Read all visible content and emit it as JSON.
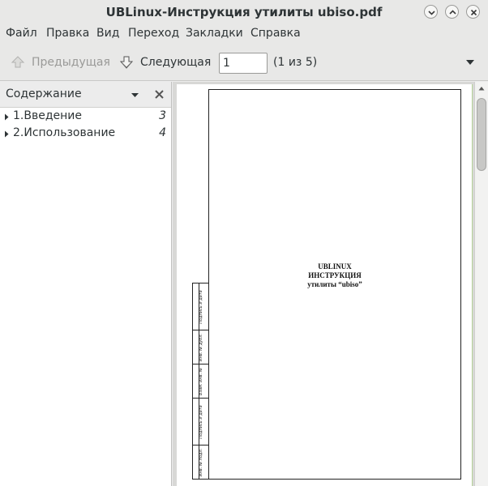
{
  "window": {
    "title": "UBLinux-Инструкция утилиты ubiso.pdf"
  },
  "menubar": {
    "items": [
      "Файл",
      "Правка",
      "Вид",
      "Переход",
      "Закладки",
      "Справка"
    ]
  },
  "toolbar": {
    "prev_label": "Предыдущая",
    "next_label": "Следующая",
    "page_value": "1",
    "page_count": "(1 из 5)"
  },
  "sidebar": {
    "title": "Содержание",
    "items": [
      {
        "label": "1.Введение",
        "page": "3"
      },
      {
        "label": "2.Использование",
        "page": "4"
      }
    ]
  },
  "document": {
    "title_lines": [
      "UBLINUX",
      "ИНСТРУКЦИЯ",
      "утилиты “ubiso”"
    ],
    "stamp_labels": [
      "Подпись и дата",
      "Инв. № дубл.",
      "Взам. инв. №",
      "Подпись и дата",
      "Инв. № подл."
    ]
  },
  "colors": {
    "chrome": "#e8e8e7",
    "page": "#ffffff",
    "viewer_bg": "#d8d8d6"
  }
}
